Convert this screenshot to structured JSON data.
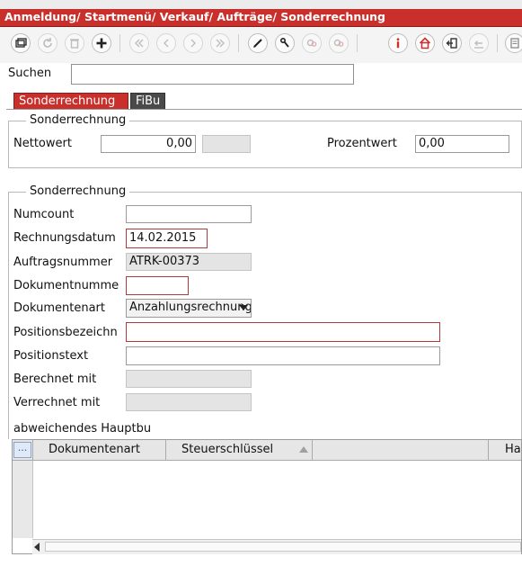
{
  "title": "Anmeldung/ Startmenü/ Verkauf/ Aufträge/ Sonderrechnung",
  "toolbar": {
    "icons": [
      "window-icon",
      "refresh-icon",
      "trash-icon",
      "add-icon",
      "first-icon",
      "prev-icon",
      "next-icon",
      "last-icon",
      "edit-icon",
      "tool-icon",
      "search-link-icon",
      "search-unlink-icon",
      "info-icon",
      "home-icon",
      "exit-icon",
      "import-icon",
      "menu-icon"
    ]
  },
  "search": {
    "label": "Suchen",
    "value": ""
  },
  "tabs": [
    {
      "label": "Sonderrechnung",
      "active": true
    },
    {
      "label": "FiBu",
      "active": false
    }
  ],
  "group1": {
    "legend": "Sonderrechnung",
    "nettowert_label": "Nettowert",
    "nettowert_value": "0,00",
    "nettowert_extra": "",
    "prozentwert_label": "Prozentwert",
    "prozentwert_value": "0,00"
  },
  "group2": {
    "legend": "Sonderrechnung",
    "fields": {
      "numcount": {
        "label": "Numcount",
        "value": ""
      },
      "rechnungsdatum": {
        "label": "Rechnungsdatum",
        "value": "14.02.2015"
      },
      "auftragsnummer": {
        "label": "Auftragsnummer",
        "value": "ATRK-00373"
      },
      "dokumentnummer": {
        "label": "Dokumentnumme",
        "value": ""
      },
      "dokumentenart": {
        "label": "Dokumentenart",
        "value": "Anzahlungsrechnung"
      },
      "positionsbezeichnung": {
        "label": "Positionsbezeichn",
        "value": ""
      },
      "positionstext": {
        "label": "Positionstext",
        "value": ""
      },
      "berechnet_mit": {
        "label": "Berechnet mit",
        "value": ""
      },
      "verrechnet_mit": {
        "label": "Verrechnet mit",
        "value": ""
      }
    }
  },
  "table": {
    "section_label": "abweichendes Hauptbu",
    "button_label": "...",
    "columns": [
      "Dokumentenart",
      "Steuerschlüssel",
      "",
      "Ha"
    ],
    "rows": []
  },
  "colors": {
    "accent": "#c9302c",
    "tab_inactive": "#4a4a4a"
  }
}
